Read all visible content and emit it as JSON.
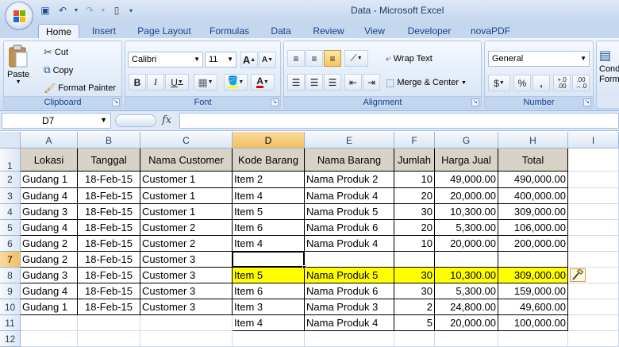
{
  "window": {
    "title": "Data - Microsoft Excel"
  },
  "tabs": [
    "Home",
    "Insert",
    "Page Layout",
    "Formulas",
    "Data",
    "Review",
    "View",
    "Developer",
    "novaPDF"
  ],
  "ribbon": {
    "clipboard": {
      "paste": "Paste",
      "cut": "Cut",
      "copy": "Copy",
      "format_painter": "Format Painter",
      "label": "Clipboard"
    },
    "font": {
      "name": "Calibri",
      "size": "11",
      "bold": "B",
      "italic": "I",
      "underline": "U",
      "grow": "A",
      "shrink": "A",
      "label": "Font"
    },
    "alignment": {
      "wrap_text": "Wrap Text",
      "merge_center": "Merge & Center",
      "label": "Alignment"
    },
    "number": {
      "format": "General",
      "currency": "$",
      "percent": "%",
      "comma": ",",
      "inc_decimal": ".00",
      "inc_decimal_b": "+.0",
      "dec_decimal": ".00",
      "dec_decimal_b": "→.0",
      "label": "Number"
    },
    "styles": {
      "conditional_a": "Cond",
      "conditional_b": "Form"
    }
  },
  "formula_bar": {
    "name_box": "D7",
    "fx": "fx",
    "formula": ""
  },
  "columns": [
    "A",
    "B",
    "C",
    "D",
    "E",
    "F",
    "G",
    "H",
    "I"
  ],
  "selected_column": "D",
  "selected_row": "7",
  "rows": [
    "1",
    "2",
    "3",
    "4",
    "5",
    "6",
    "7",
    "8",
    "9",
    "10",
    "11",
    "12"
  ],
  "headers": [
    "Lokasi",
    "Tanggal",
    "Nama Customer",
    "Kode Barang",
    "Nama Barang",
    "Jumlah",
    "Harga Jual",
    "Total"
  ],
  "data": [
    [
      "Gudang 1",
      "18-Feb-15",
      "Customer 1",
      "Item 2",
      "Nama Produk 2",
      "10",
      "49,000.00",
      "490,000.00"
    ],
    [
      "Gudang 4",
      "18-Feb-15",
      "Customer 1",
      "Item 4",
      "Nama Produk 4",
      "20",
      "20,000.00",
      "400,000.00"
    ],
    [
      "Gudang 3",
      "18-Feb-15",
      "Customer 1",
      "Item 5",
      "Nama Produk 5",
      "30",
      "10,300.00",
      "309,000.00"
    ],
    [
      "Gudang 4",
      "18-Feb-15",
      "Customer 2",
      "Item 6",
      "Nama Produk 6",
      "20",
      "5,300.00",
      "106,000.00"
    ],
    [
      "Gudang 2",
      "18-Feb-15",
      "Customer 2",
      "Item 4",
      "Nama Produk 4",
      "10",
      "20,000.00",
      "200,000.00"
    ],
    [
      "Gudang 2",
      "18-Feb-15",
      "Customer 3",
      "",
      "",
      "",
      "",
      ""
    ],
    [
      "Gudang 3",
      "18-Feb-15",
      "Customer 3",
      "Item 5",
      "Nama Produk 5",
      "30",
      "10,300.00",
      "309,000.00"
    ],
    [
      "Gudang 4",
      "18-Feb-15",
      "Customer 3",
      "Item 6",
      "Nama Produk 6",
      "30",
      "5,300.00",
      "159,000.00"
    ],
    [
      "Gudang 1",
      "18-Feb-15",
      "Customer 3",
      "Item 3",
      "Nama Produk 3",
      "2",
      "24,800.00",
      "49,600.00"
    ],
    [
      "",
      "",
      "",
      "Item 4",
      "Nama Produk 4",
      "5",
      "20,000.00",
      "100,000.00"
    ]
  ],
  "highlight_color": "#ffff00",
  "header_fill": "#d9d3c7",
  "accent": "#f1c15f"
}
